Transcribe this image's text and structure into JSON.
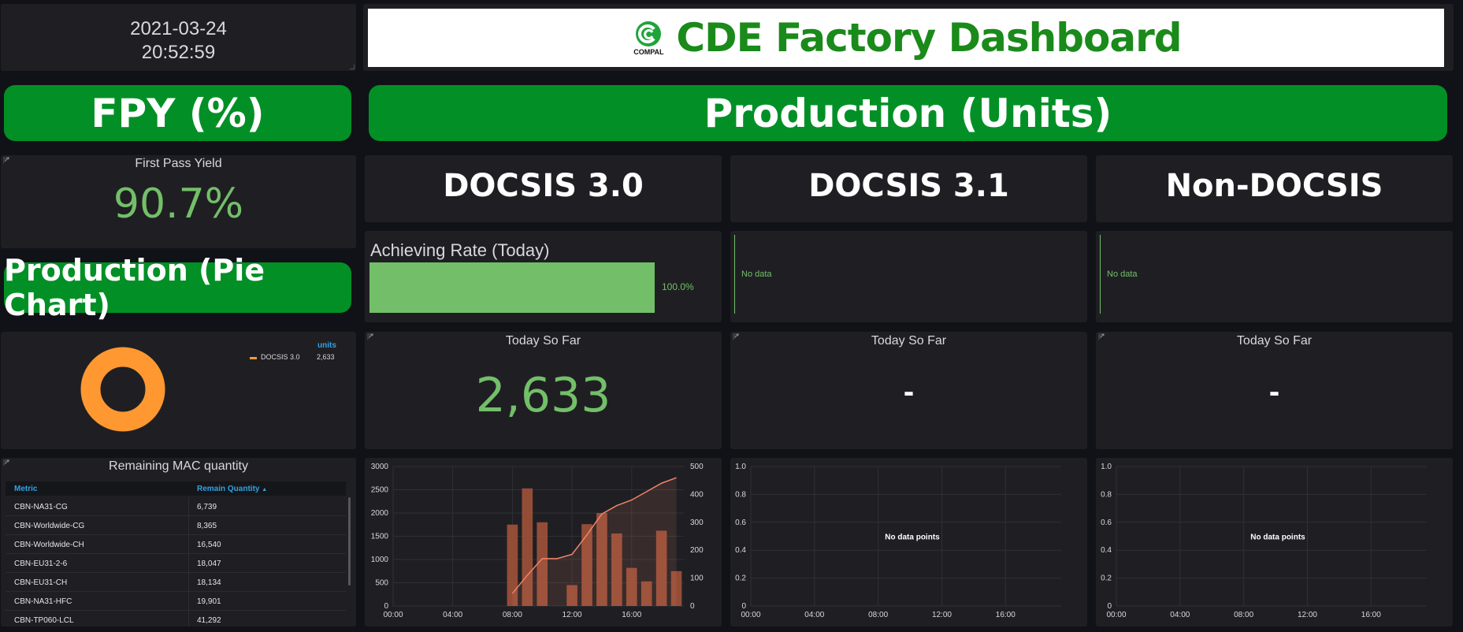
{
  "clock": {
    "date": "2021-03-24",
    "time": "20:52:59"
  },
  "title": {
    "logo_text": "COMPAL",
    "text": "CDE Factory Dashboard"
  },
  "banners": {
    "fpy": "FPY (%)",
    "production": "Production (Units)",
    "pie": "Production (Pie Chart)"
  },
  "fpy_panel": {
    "title": "First Pass Yield",
    "value": "90.7%"
  },
  "columns": {
    "docsis30": {
      "header": "DOCSIS 3.0"
    },
    "docsis31": {
      "header": "DOCSIS 3.1"
    },
    "nondocsis": {
      "header": "Non-DOCSIS"
    }
  },
  "achieving": {
    "title": "Achieving Rate (Today)",
    "value_label": "100.0%",
    "fraction": 1.0
  },
  "nodata": {
    "label": "No data",
    "points_label": "No data points"
  },
  "today": {
    "title": "Today So Far",
    "docsis30_value": "2,633",
    "docsis31_value": "-",
    "nondocsis_value": "-"
  },
  "pie": {
    "legend_header": "units",
    "legend_item": "DOCSIS 3.0",
    "legend_value": "2,633",
    "color": "#ff9830"
  },
  "mac_table": {
    "title": "Remaining MAC quantity",
    "col_metric": "Metric",
    "col_quantity": "Remain Quantity",
    "sort_indicator": "▲",
    "rows": [
      {
        "metric": "CBN-NA31-CG",
        "qty": "6,739"
      },
      {
        "metric": "CBN-Worldwide-CG",
        "qty": "8,365"
      },
      {
        "metric": "CBN-Worldwide-CH",
        "qty": "16,540"
      },
      {
        "metric": "CBN-EU31-2-6",
        "qty": "18,047"
      },
      {
        "metric": "CBN-EU31-CH",
        "qty": "18,134"
      },
      {
        "metric": "CBN-NA31-HFC",
        "qty": "19,901"
      },
      {
        "metric": "CBN-TP060-LCL",
        "qty": "41,292"
      }
    ]
  },
  "colors": {
    "banner_green": "#029026",
    "value_green": "#73bf69",
    "bar_orange": "#a0523a",
    "line_orange": "#f2846a",
    "table_header_blue": "#33a2e5"
  },
  "chart_data": [
    {
      "type": "bar",
      "x": [
        "08:00",
        "09:00",
        "10:00",
        "11:00",
        "12:00",
        "13:00",
        "14:00",
        "15:00",
        "16:00",
        "17:00",
        "18:00",
        "19:00"
      ],
      "x_ticks": [
        "00:00",
        "04:00",
        "08:00",
        "12:00",
        "16:00"
      ],
      "y_left_ticks": [
        "0",
        "500",
        "1000",
        "1500",
        "2000",
        "2500",
        "3000"
      ],
      "y_right_ticks": [
        "0",
        "100",
        "200",
        "300",
        "400",
        "500"
      ],
      "ylim_left": [
        0,
        3000
      ],
      "ylim_right": [
        0,
        500
      ],
      "series": [
        {
          "values": [
            1750,
            2530,
            1800,
            0,
            450,
            1760,
            2000,
            1560,
            820,
            530,
            1620,
            750
          ]
        },
        {
          "axis": "right",
          "type": "line",
          "values": [
            45,
            110,
            170,
            170,
            185,
            255,
            330,
            360,
            380,
            410,
            440,
            460
          ]
        }
      ],
      "grid": true
    },
    {
      "type": "line",
      "x_ticks": [
        "00:00",
        "04:00",
        "08:00",
        "12:00",
        "16:00"
      ],
      "y_ticks": [
        "0",
        "0.2",
        "0.4",
        "0.6",
        "0.8",
        "1.0"
      ],
      "ylim": [
        0,
        1
      ],
      "series": [],
      "annotation": "No data points",
      "grid": true
    },
    {
      "type": "line",
      "x_ticks": [
        "00:00",
        "04:00",
        "08:00",
        "12:00",
        "16:00"
      ],
      "y_ticks": [
        "0",
        "0.2",
        "0.4",
        "0.6",
        "0.8",
        "1.0"
      ],
      "ylim": [
        0,
        1
      ],
      "series": [],
      "annotation": "No data points",
      "grid": true
    }
  ]
}
